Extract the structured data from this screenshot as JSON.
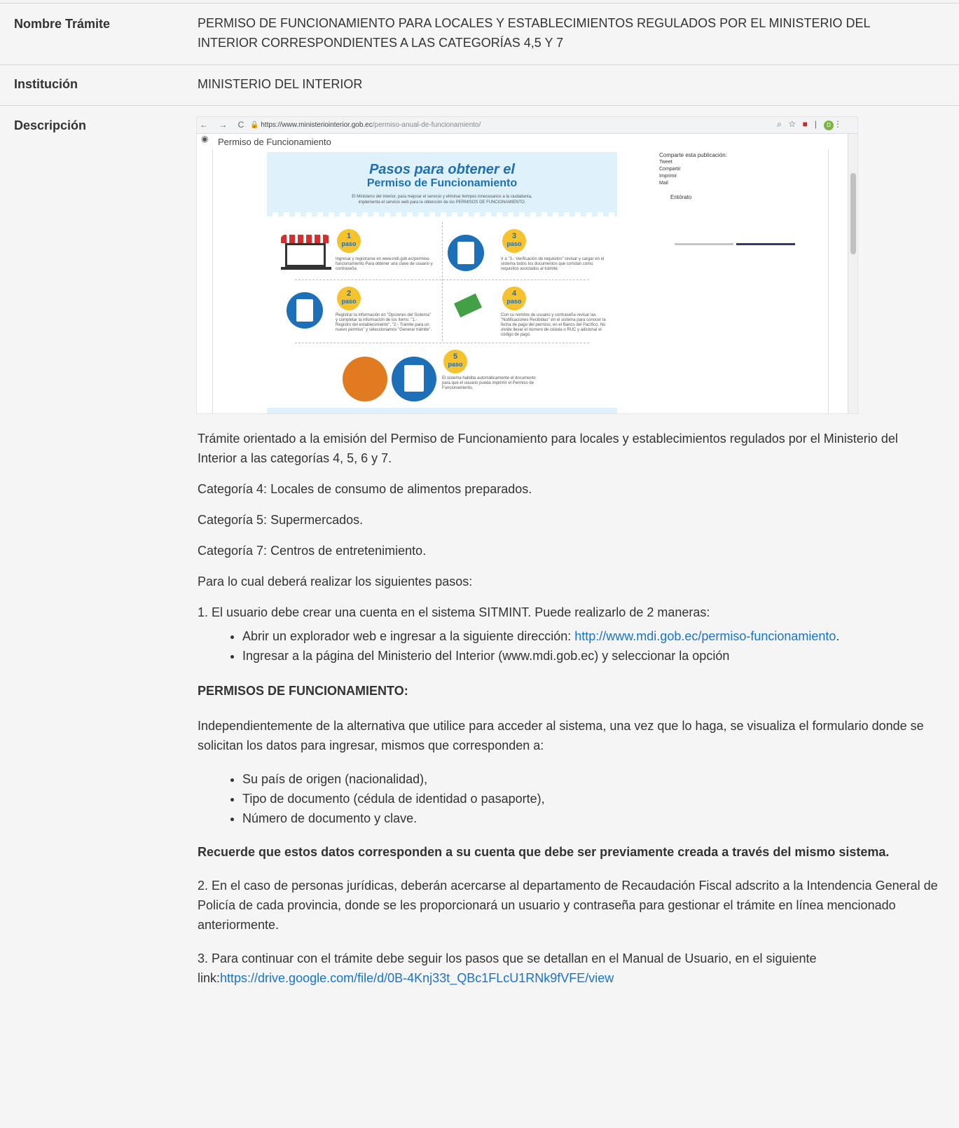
{
  "rows": {
    "nombre": {
      "label": "Nombre Trámite",
      "value": "PERMISO DE FUNCIONAMIENTO PARA LOCALES Y ESTABLECIMIENTOS REGULADOS POR EL MINISTERIO DEL INTERIOR CORRESPONDIENTES A LAS CATEGORÍAS 4,5 Y 7"
    },
    "institucion": {
      "label": "Institución",
      "value": "MINISTERIO DEL INTERIOR"
    },
    "descripcion": {
      "label": "Descripción"
    }
  },
  "screenshot": {
    "url_domain": "https://www.ministeriointerior.gob.ec",
    "url_path": "/permiso-anual-de-funcionamiento/",
    "badge_letter": "D",
    "page_heading": "Permiso de Funcionamiento",
    "infographic": {
      "title_line1": "Pasos para obtener el",
      "title_line2": "Permiso de Funcionamiento",
      "subtitle": "El Ministerio del Interior, para mejorar el servicio y eliminar tiempos innecesarios a la ciudadanía, implementa el servicio web para la obtención de los PERMISOS DE FUNCIONAMIENTO.",
      "steps": [
        {
          "num": "1",
          "word": "paso",
          "text": "Ingresar y registrarse en www.mdi.gob.ec/permiso-funcionamiento Para obtener una clave de usuario y contraseña."
        },
        {
          "num": "3",
          "word": "paso",
          "text": "Ir a \"3.- Verificación de requisitos\" revisar y cargar en el sistema todos los documentos que constan como requisitos asociados al trámite."
        },
        {
          "num": "2",
          "word": "paso",
          "text": "Registrar la información en \"Opciones del Sistema\" y completar la información de los ítems: \"1.- Registro del establecimiento\", \"2.- Trámite para un nuevo permiso\" y seleccionamos \"Generar trámite\"."
        },
        {
          "num": "4",
          "word": "paso",
          "text": "Con su nombre de usuario y contraseña revisar las \"Notificaciones Recibidas\" en el sistema para conocer la fecha de pago del permiso, en el Banco del Pacífico. No olvide llevar el número de cédula o RUC y adicional el código de pago."
        },
        {
          "num": "5",
          "word": "paso",
          "text": "El sistema habilita automáticamente el documento para que el usuario pueda imprimir el Permiso de Funcionamiento."
        }
      ]
    },
    "sidebar": {
      "share_label": "Comparte esta publicación:",
      "items": [
        "Tweet",
        "Compartir",
        "Imprimir",
        "Mail"
      ],
      "entorato": "Entórato"
    }
  },
  "description": {
    "intro": "Trámite orientado a la emisión del Permiso de Funcionamiento para locales y establecimientos regulados por el Ministerio del Interior a las categorías 4, 5, 6 y 7.",
    "cat4": "Categoría 4: Locales de consumo de alimentos preparados.",
    "cat5": "Categoría 5: Supermercados.",
    "cat7": "Categoría 7: Centros de entretenimiento.",
    "pasos_intro": "Para lo cual deberá realizar los siguientes pasos:",
    "step1": "1. El usuario debe crear una cuenta en el sistema SITMINT. Puede realizarlo de 2 maneras:",
    "bullet1_text": "Abrir un explorador web e ingresar a la siguiente dirección: ",
    "bullet1_link": "http://www.mdi.gob.ec/permiso-funcionamiento",
    "bullet1_end": ".",
    "bullet2": "Ingresar a la página del Ministerio del Interior (www.mdi.gob.ec) y seleccionar la opción",
    "permisos_heading": "PERMISOS DE FUNCIONAMIENTO:",
    "independiente": "Independientemente de la alternativa que utilice para acceder al sistema, una vez que lo haga, se visualiza el formulario donde se solicitan los datos para ingresar, mismos que corresponden a:",
    "datos": [
      "Su país de origen (nacionalidad),",
      "Tipo de documento (cédula de identidad o pasaporte),",
      "Número de documento y clave."
    ],
    "recuerde": "Recuerde que estos datos corresponden a su cuenta que debe ser previamente creada a través del mismo sistema.",
    "step2": "2. En el caso de personas jurídicas, deberán acercarse al departamento de Recaudación Fiscal adscrito a la Intendencia General de Policía de cada provincia, donde se les proporcionará un usuario y contraseña para gestionar el trámite en línea mencionado anteriormente.",
    "step3_text": "3. Para continuar con el trámite debe seguir los pasos que se detallan en el Manual de Usuario, en el siguiente link:",
    "step3_link": "https://drive.google.com/file/d/0B-4Knj33t_QBc1FLcU1RNk9fVFE/view"
  }
}
